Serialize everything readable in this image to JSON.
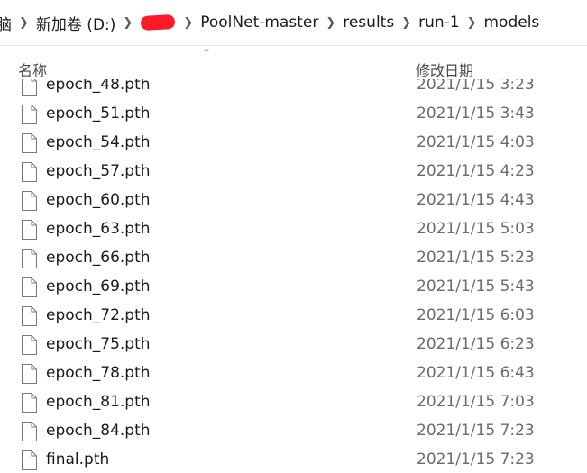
{
  "breadcrumb": {
    "items": [
      "脑",
      "新加卷 (D:)",
      "PoolNet-master",
      "results",
      "run-1",
      "models"
    ],
    "separator_icon": "chevron-right-icon",
    "redacted_color": "#ff1a2a"
  },
  "columns": {
    "name": "名称",
    "date": "修改日期"
  },
  "files": [
    {
      "name": "epoch_48.pth",
      "date": "2021/1/15 3:23"
    },
    {
      "name": "epoch_51.pth",
      "date": "2021/1/15 3:43"
    },
    {
      "name": "epoch_54.pth",
      "date": "2021/1/15 4:03"
    },
    {
      "name": "epoch_57.pth",
      "date": "2021/1/15 4:23"
    },
    {
      "name": "epoch_60.pth",
      "date": "2021/1/15 4:43"
    },
    {
      "name": "epoch_63.pth",
      "date": "2021/1/15 5:03"
    },
    {
      "name": "epoch_66.pth",
      "date": "2021/1/15 5:23"
    },
    {
      "name": "epoch_69.pth",
      "date": "2021/1/15 5:43"
    },
    {
      "name": "epoch_72.pth",
      "date": "2021/1/15 6:03"
    },
    {
      "name": "epoch_75.pth",
      "date": "2021/1/15 6:23"
    },
    {
      "name": "epoch_78.pth",
      "date": "2021/1/15 6:43"
    },
    {
      "name": "epoch_81.pth",
      "date": "2021/1/15 7:03"
    },
    {
      "name": "epoch_84.pth",
      "date": "2021/1/15 7:23"
    },
    {
      "name": "final.pth",
      "date": "2021/1/15 7:23"
    }
  ]
}
